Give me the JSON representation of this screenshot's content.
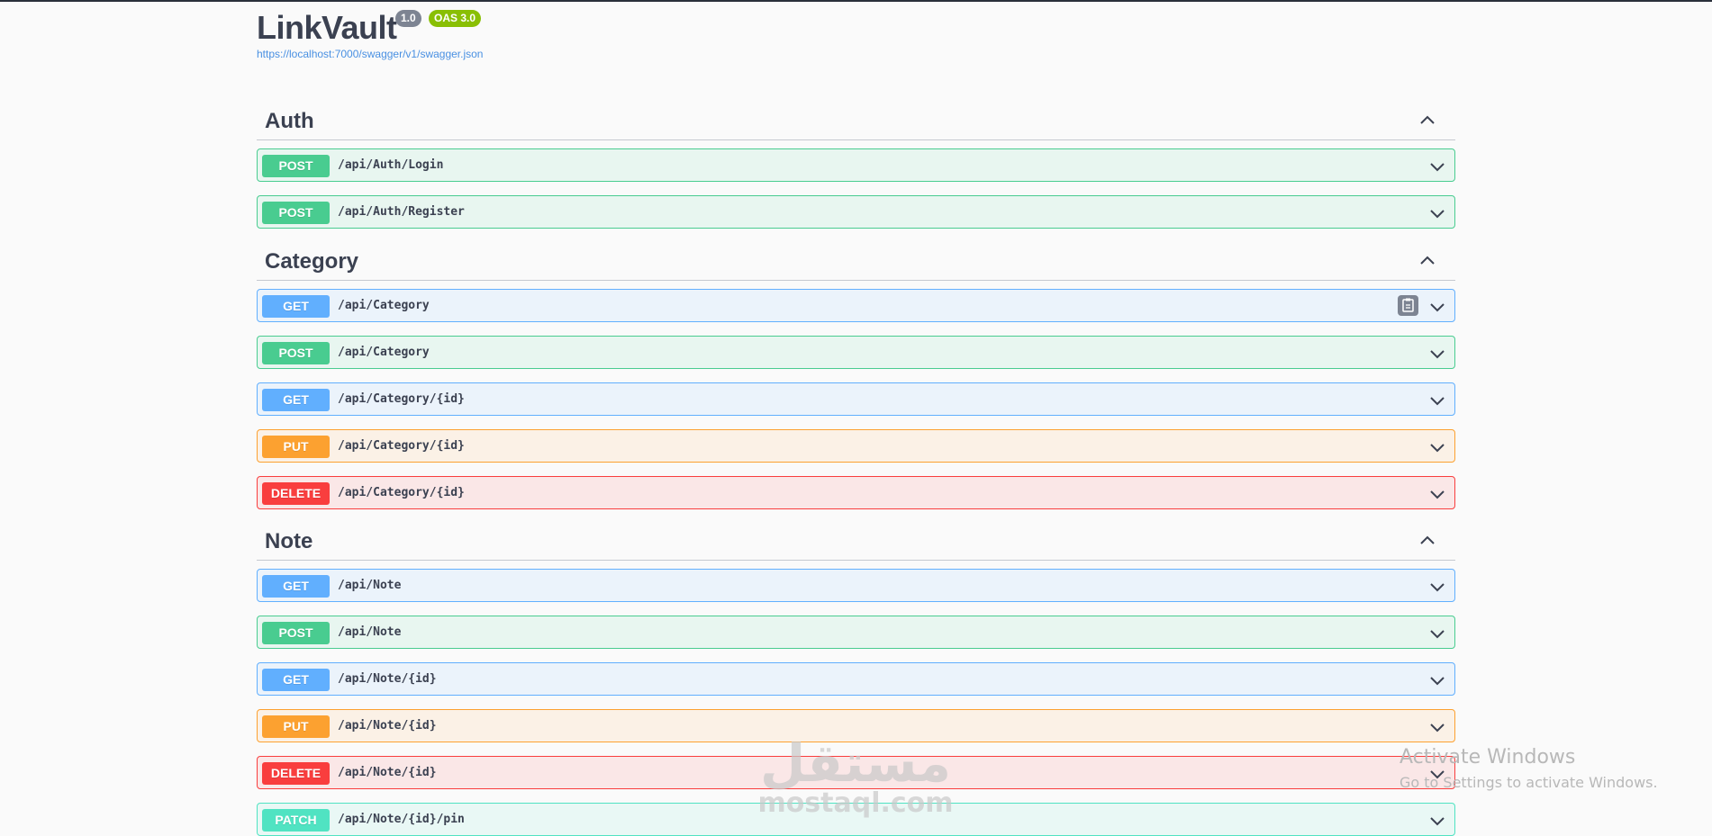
{
  "info": {
    "title": "LinkVault",
    "version": "1.0",
    "oas": "OAS 3.0",
    "url": "https://localhost:7000/swagger/v1/swagger.json"
  },
  "tags": [
    {
      "name": "Auth",
      "operations": [
        {
          "method": "POST",
          "path": "/api/Auth/Login"
        },
        {
          "method": "POST",
          "path": "/api/Auth/Register"
        }
      ]
    },
    {
      "name": "Category",
      "operations": [
        {
          "method": "GET",
          "path": "/api/Category"
        },
        {
          "method": "POST",
          "path": "/api/Category"
        },
        {
          "method": "GET",
          "path": "/api/Category/{id}"
        },
        {
          "method": "PUT",
          "path": "/api/Category/{id}"
        },
        {
          "method": "DELETE",
          "path": "/api/Category/{id}"
        }
      ]
    },
    {
      "name": "Note",
      "operations": [
        {
          "method": "GET",
          "path": "/api/Note"
        },
        {
          "method": "POST",
          "path": "/api/Note"
        },
        {
          "method": "GET",
          "path": "/api/Note/{id}"
        },
        {
          "method": "PUT",
          "path": "/api/Note/{id}"
        },
        {
          "method": "DELETE",
          "path": "/api/Note/{id}"
        },
        {
          "method": "PATCH",
          "path": "/api/Note/{id}/pin"
        }
      ]
    }
  ],
  "watermark": {
    "arabic": "مستقل",
    "latin": "mostaql.com"
  },
  "windows_activation": {
    "title": "Activate Windows",
    "subtitle": "Go to Settings to activate Windows."
  }
}
